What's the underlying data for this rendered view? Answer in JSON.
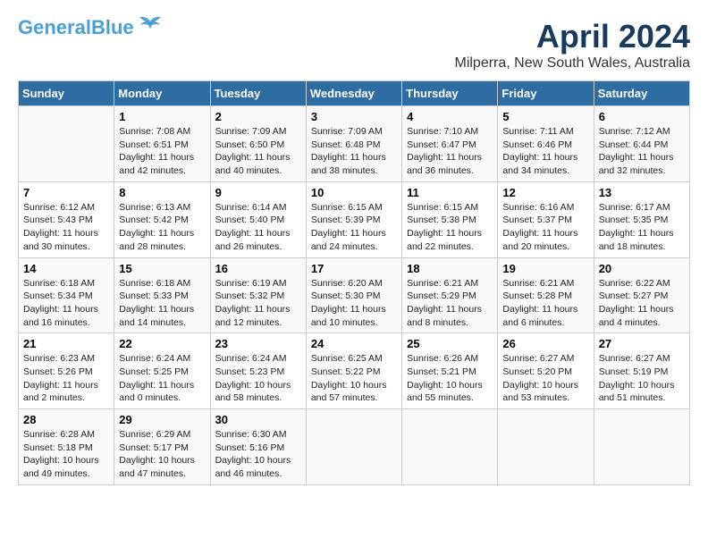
{
  "logo": {
    "line1": "General",
    "line2": "Blue"
  },
  "title": "April 2024",
  "location": "Milperra, New South Wales, Australia",
  "days_of_week": [
    "Sunday",
    "Monday",
    "Tuesday",
    "Wednesday",
    "Thursday",
    "Friday",
    "Saturday"
  ],
  "weeks": [
    [
      {
        "day": "",
        "content": ""
      },
      {
        "day": "1",
        "content": "Sunrise: 7:08 AM\nSunset: 6:51 PM\nDaylight: 11 hours\nand 42 minutes."
      },
      {
        "day": "2",
        "content": "Sunrise: 7:09 AM\nSunset: 6:50 PM\nDaylight: 11 hours\nand 40 minutes."
      },
      {
        "day": "3",
        "content": "Sunrise: 7:09 AM\nSunset: 6:48 PM\nDaylight: 11 hours\nand 38 minutes."
      },
      {
        "day": "4",
        "content": "Sunrise: 7:10 AM\nSunset: 6:47 PM\nDaylight: 11 hours\nand 36 minutes."
      },
      {
        "day": "5",
        "content": "Sunrise: 7:11 AM\nSunset: 6:46 PM\nDaylight: 11 hours\nand 34 minutes."
      },
      {
        "day": "6",
        "content": "Sunrise: 7:12 AM\nSunset: 6:44 PM\nDaylight: 11 hours\nand 32 minutes."
      }
    ],
    [
      {
        "day": "7",
        "content": "Sunrise: 6:12 AM\nSunset: 5:43 PM\nDaylight: 11 hours\nand 30 minutes."
      },
      {
        "day": "8",
        "content": "Sunrise: 6:13 AM\nSunset: 5:42 PM\nDaylight: 11 hours\nand 28 minutes."
      },
      {
        "day": "9",
        "content": "Sunrise: 6:14 AM\nSunset: 5:40 PM\nDaylight: 11 hours\nand 26 minutes."
      },
      {
        "day": "10",
        "content": "Sunrise: 6:15 AM\nSunset: 5:39 PM\nDaylight: 11 hours\nand 24 minutes."
      },
      {
        "day": "11",
        "content": "Sunrise: 6:15 AM\nSunset: 5:38 PM\nDaylight: 11 hours\nand 22 minutes."
      },
      {
        "day": "12",
        "content": "Sunrise: 6:16 AM\nSunset: 5:37 PM\nDaylight: 11 hours\nand 20 minutes."
      },
      {
        "day": "13",
        "content": "Sunrise: 6:17 AM\nSunset: 5:35 PM\nDaylight: 11 hours\nand 18 minutes."
      }
    ],
    [
      {
        "day": "14",
        "content": "Sunrise: 6:18 AM\nSunset: 5:34 PM\nDaylight: 11 hours\nand 16 minutes."
      },
      {
        "day": "15",
        "content": "Sunrise: 6:18 AM\nSunset: 5:33 PM\nDaylight: 11 hours\nand 14 minutes."
      },
      {
        "day": "16",
        "content": "Sunrise: 6:19 AM\nSunset: 5:32 PM\nDaylight: 11 hours\nand 12 minutes."
      },
      {
        "day": "17",
        "content": "Sunrise: 6:20 AM\nSunset: 5:30 PM\nDaylight: 11 hours\nand 10 minutes."
      },
      {
        "day": "18",
        "content": "Sunrise: 6:21 AM\nSunset: 5:29 PM\nDaylight: 11 hours\nand 8 minutes."
      },
      {
        "day": "19",
        "content": "Sunrise: 6:21 AM\nSunset: 5:28 PM\nDaylight: 11 hours\nand 6 minutes."
      },
      {
        "day": "20",
        "content": "Sunrise: 6:22 AM\nSunset: 5:27 PM\nDaylight: 11 hours\nand 4 minutes."
      }
    ],
    [
      {
        "day": "21",
        "content": "Sunrise: 6:23 AM\nSunset: 5:26 PM\nDaylight: 11 hours\nand 2 minutes."
      },
      {
        "day": "22",
        "content": "Sunrise: 6:24 AM\nSunset: 5:25 PM\nDaylight: 11 hours\nand 0 minutes."
      },
      {
        "day": "23",
        "content": "Sunrise: 6:24 AM\nSunset: 5:23 PM\nDaylight: 10 hours\nand 58 minutes."
      },
      {
        "day": "24",
        "content": "Sunrise: 6:25 AM\nSunset: 5:22 PM\nDaylight: 10 hours\nand 57 minutes."
      },
      {
        "day": "25",
        "content": "Sunrise: 6:26 AM\nSunset: 5:21 PM\nDaylight: 10 hours\nand 55 minutes."
      },
      {
        "day": "26",
        "content": "Sunrise: 6:27 AM\nSunset: 5:20 PM\nDaylight: 10 hours\nand 53 minutes."
      },
      {
        "day": "27",
        "content": "Sunrise: 6:27 AM\nSunset: 5:19 PM\nDaylight: 10 hours\nand 51 minutes."
      }
    ],
    [
      {
        "day": "28",
        "content": "Sunrise: 6:28 AM\nSunset: 5:18 PM\nDaylight: 10 hours\nand 49 minutes."
      },
      {
        "day": "29",
        "content": "Sunrise: 6:29 AM\nSunset: 5:17 PM\nDaylight: 10 hours\nand 47 minutes."
      },
      {
        "day": "30",
        "content": "Sunrise: 6:30 AM\nSunset: 5:16 PM\nDaylight: 10 hours\nand 46 minutes."
      },
      {
        "day": "",
        "content": ""
      },
      {
        "day": "",
        "content": ""
      },
      {
        "day": "",
        "content": ""
      },
      {
        "day": "",
        "content": ""
      }
    ]
  ]
}
